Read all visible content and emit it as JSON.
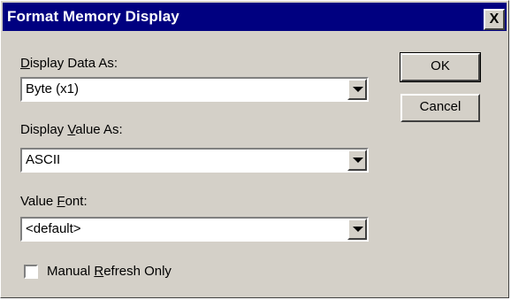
{
  "window": {
    "title": "Format Memory Display",
    "close_label": "X"
  },
  "fields": {
    "display_data_as": {
      "label_pre": "",
      "label_accel": "D",
      "label_post": "isplay Data As:",
      "value": "Byte (x1)"
    },
    "display_value_as": {
      "label_pre": "Display ",
      "label_accel": "V",
      "label_post": "alue As:",
      "value": "ASCII"
    },
    "value_font": {
      "label_pre": "Value ",
      "label_accel": "F",
      "label_post": "ont:",
      "value": "<default>"
    }
  },
  "checkbox": {
    "label_pre": "Manual ",
    "label_accel": "R",
    "label_post": "efresh Only",
    "checked": false
  },
  "buttons": {
    "ok": "OK",
    "cancel": "Cancel"
  },
  "colors": {
    "titlebar": "#000080",
    "face": "#d4d0c8"
  }
}
